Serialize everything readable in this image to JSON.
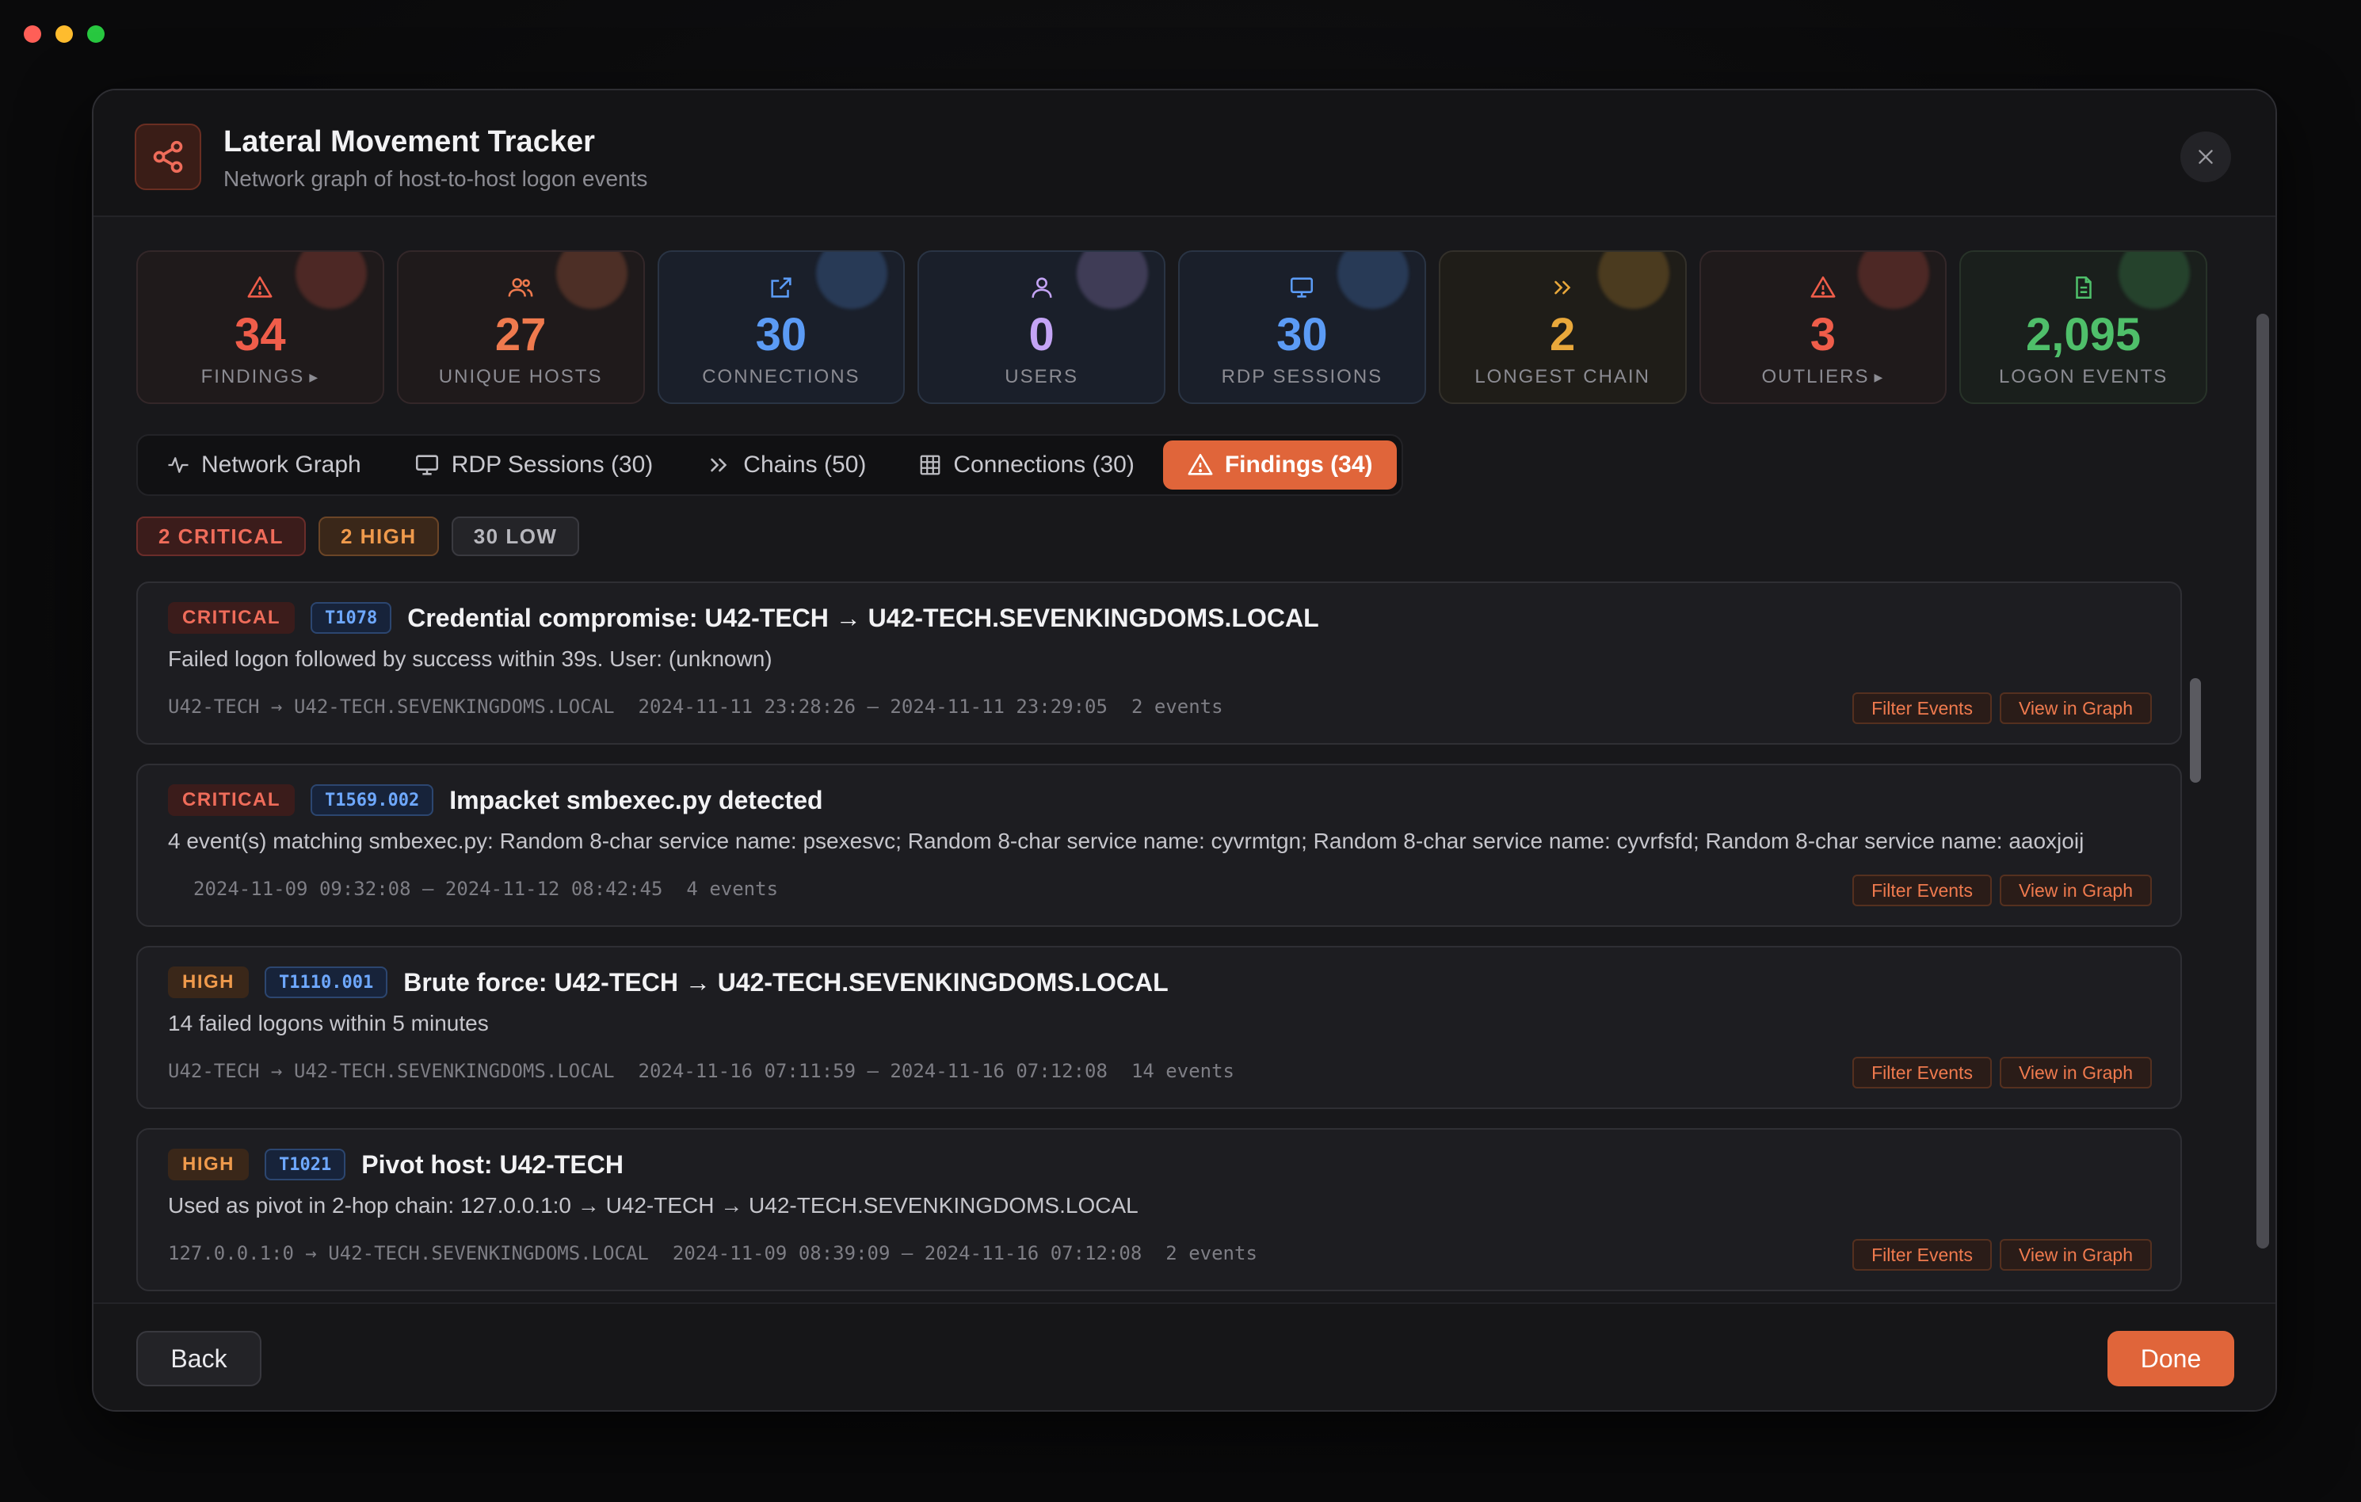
{
  "window": {
    "controls": [
      "close",
      "minimize",
      "zoom"
    ]
  },
  "header": {
    "title": "Lateral Movement Tracker",
    "subtitle": "Network graph of host-to-host logon events",
    "logo_icon": "share-graph-icon",
    "close_icon": "close-icon"
  },
  "stats": [
    {
      "value": "34",
      "label": "FINDINGS",
      "caret": true,
      "icon": "warning-icon",
      "color": "#ef5d4a",
      "tone": "red"
    },
    {
      "value": "27",
      "label": "UNIQUE HOSTS",
      "caret": false,
      "icon": "users-icon",
      "color": "#ef7a4e",
      "tone": "red"
    },
    {
      "value": "30",
      "label": "CONNECTIONS",
      "caret": false,
      "icon": "external-link-icon",
      "color": "#5b9bf5",
      "tone": "blue"
    },
    {
      "value": "0",
      "label": "USERS",
      "caret": false,
      "icon": "user-icon",
      "color": "#c4a4f5",
      "tone": "blue"
    },
    {
      "value": "30",
      "label": "RDP SESSIONS",
      "caret": false,
      "icon": "monitor-icon",
      "color": "#5b9bf5",
      "tone": "blue"
    },
    {
      "value": "2",
      "label": "LONGEST CHAIN",
      "caret": false,
      "icon": "chevrons-right-icon",
      "color": "#e9a83b",
      "tone": "amber"
    },
    {
      "value": "3",
      "label": "OUTLIERS",
      "caret": true,
      "icon": "warning-icon",
      "color": "#ef5d4a",
      "tone": "red"
    },
    {
      "value": "2,095",
      "label": "LOGON EVENTS",
      "caret": false,
      "icon": "document-icon",
      "color": "#4fbf6a",
      "tone": "green"
    }
  ],
  "tabs": [
    {
      "label": "Network Graph",
      "icon": "activity-icon",
      "active": false
    },
    {
      "label": "RDP Sessions (30)",
      "icon": "monitor-icon",
      "active": false
    },
    {
      "label": "Chains (50)",
      "icon": "chevrons-right-icon",
      "active": false
    },
    {
      "label": "Connections (30)",
      "icon": "grid-icon",
      "active": false
    },
    {
      "label": "Findings (34)",
      "icon": "warning-icon",
      "active": true
    }
  ],
  "severity_filters": {
    "critical": "2 CRITICAL",
    "high": "2 HIGH",
    "low": "30 LOW"
  },
  "findings": [
    {
      "severity": "CRITICAL",
      "technique": "T1078",
      "title": "Credential compromise: U42-TECH → U42-TECH.SEVENKINGDOMS.LOCAL",
      "description": "Failed logon followed by success within 39s. User: (unknown)",
      "path": "U42-TECH → U42-TECH.SEVENKINGDOMS.LOCAL",
      "timerange": "2024-11-11 23:28:26 — 2024-11-11 23:29:05",
      "events": "2 events"
    },
    {
      "severity": "CRITICAL",
      "technique": "T1569.002",
      "title": "Impacket smbexec.py detected",
      "description": "4 event(s) matching smbexec.py: Random 8-char service name: psexesvc; Random 8-char service name: cyvrmtgn; Random 8-char service name: cyvrfsfd; Random 8-char service name: aaoxjoij",
      "path": "",
      "timerange": "2024-11-09 09:32:08 — 2024-11-12 08:42:45",
      "events": "4 events"
    },
    {
      "severity": "HIGH",
      "technique": "T1110.001",
      "title": "Brute force: U42-TECH → U42-TECH.SEVENKINGDOMS.LOCAL",
      "description": "14 failed logons within 5 minutes",
      "path": "U42-TECH → U42-TECH.SEVENKINGDOMS.LOCAL",
      "timerange": "2024-11-16 07:11:59 — 2024-11-16 07:12:08",
      "events": "14 events"
    },
    {
      "severity": "HIGH",
      "technique": "T1021",
      "title": "Pivot host: U42-TECH",
      "description": "Used as pivot in 2-hop chain: 127.0.0.1:0 → U42-TECH → U42-TECH.SEVENKINGDOMS.LOCAL",
      "path": "127.0.0.1:0 → U42-TECH.SEVENKINGDOMS.LOCAL",
      "timerange": "2024-11-09 08:39:09 — 2024-11-16 07:12:08",
      "events": "2 events"
    }
  ],
  "finding_actions": {
    "filter": "Filter Events",
    "graph": "View in Graph"
  },
  "footer": {
    "back": "Back",
    "done": "Done"
  },
  "colors": {
    "accent": "#e0653a",
    "critical": "#ef6c5a",
    "high": "#ef9a4c",
    "technique": "#6ea8ff"
  }
}
